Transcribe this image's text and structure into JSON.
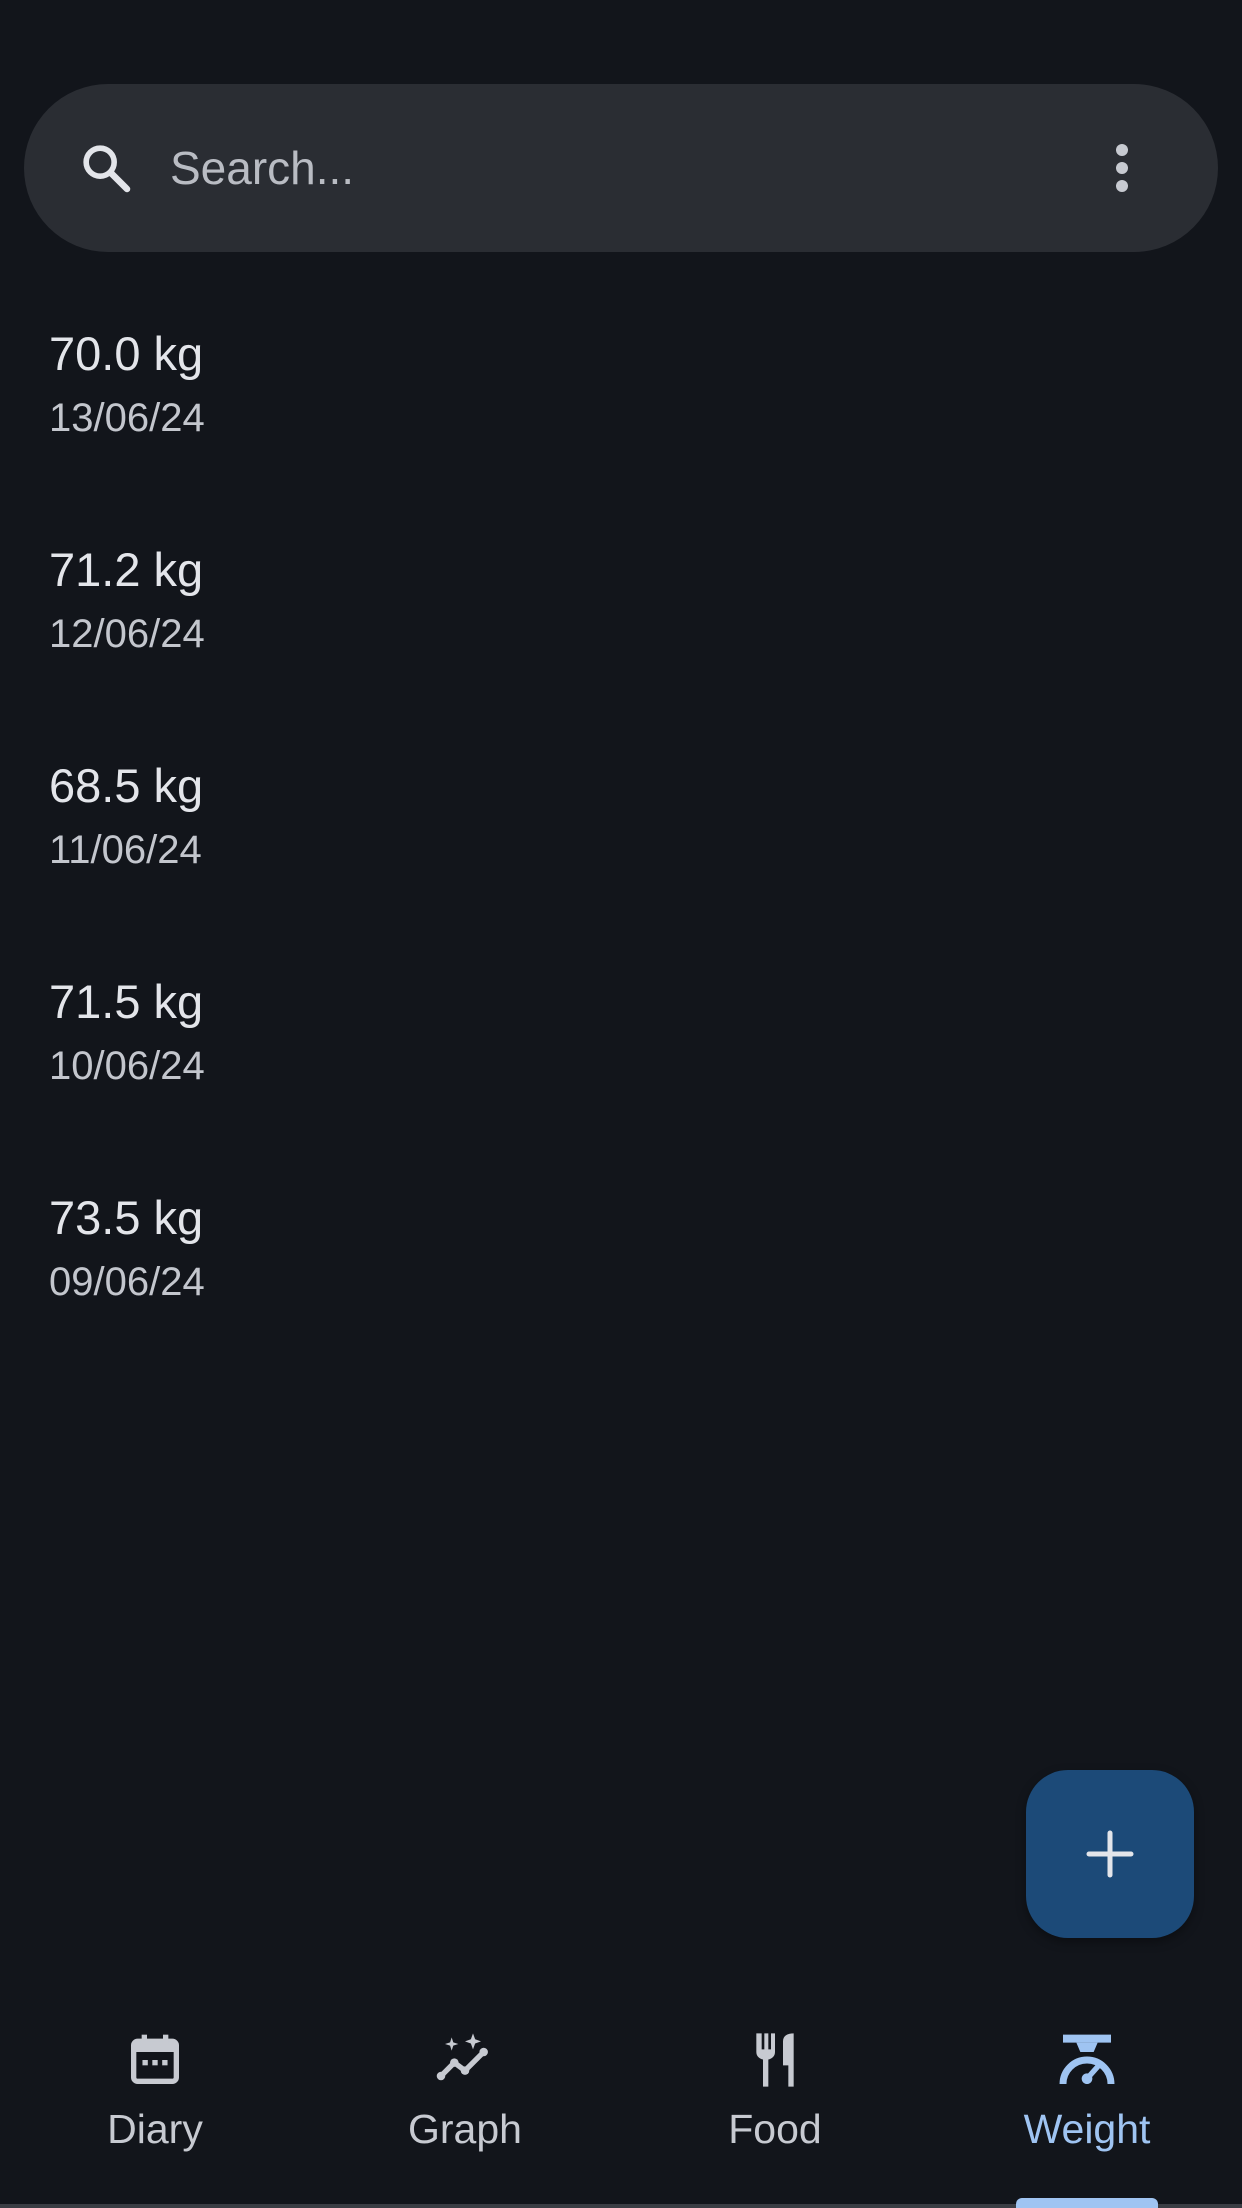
{
  "search": {
    "placeholder": "Search..."
  },
  "entries": [
    {
      "weight": "70.0 kg",
      "date": "13/06/24"
    },
    {
      "weight": "71.2 kg",
      "date": "12/06/24"
    },
    {
      "weight": "68.5 kg",
      "date": "11/06/24"
    },
    {
      "weight": "71.5 kg",
      "date": "10/06/24"
    },
    {
      "weight": "73.5 kg",
      "date": "09/06/24"
    }
  ],
  "fab": {
    "icon": "plus-icon"
  },
  "nav": {
    "items": [
      {
        "label": "Diary",
        "icon": "calendar-icon"
      },
      {
        "label": "Graph",
        "icon": "graph-icon"
      },
      {
        "label": "Food",
        "icon": "fork-knife-icon"
      },
      {
        "label": "Weight",
        "icon": "scale-icon"
      }
    ],
    "active": "Weight"
  },
  "colors": {
    "background": "#12151b",
    "search_bg": "#2a2d33",
    "fab_bg": "#1c4a78",
    "accent": "#9fc4f2",
    "text_primary": "#e3e5ea",
    "text_secondary": "#c3c6cd"
  }
}
